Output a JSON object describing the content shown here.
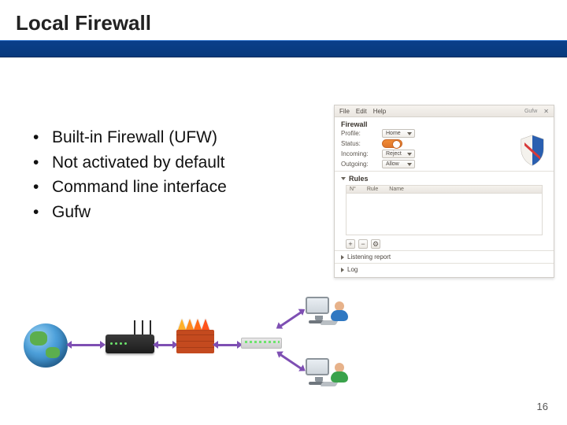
{
  "title": "Local Firewall",
  "bullets": [
    "Built-in Firewall (UFW)",
    "Not activated by default",
    "Command line interface",
    "Gufw"
  ],
  "page_number": "16",
  "gufw": {
    "menus": [
      "File",
      "Edit",
      "Help"
    ],
    "window_badge": "Gufw",
    "section_firewall": "Firewall",
    "profile_label": "Profile:",
    "profile_value": "Home",
    "status_label": "Status:",
    "incoming_label": "Incoming:",
    "incoming_value": "Reject",
    "outgoing_label": "Outgoing:",
    "outgoing_value": "Allow",
    "section_rules": "Rules",
    "rules_cols": [
      "N°",
      "Rule",
      "Name"
    ],
    "btn_plus": "+",
    "btn_minus": "−",
    "btn_gear": "⚙",
    "section_listening": "Listening report",
    "section_log": "Log",
    "window_close": "✕"
  },
  "diagram": {
    "flame_colors": [
      "#ffb02a",
      "#ff8a1f",
      "#ff6a17",
      "#ff521a"
    ],
    "person1_color": "#2f78c2",
    "person2_color": "#3aa24b"
  }
}
